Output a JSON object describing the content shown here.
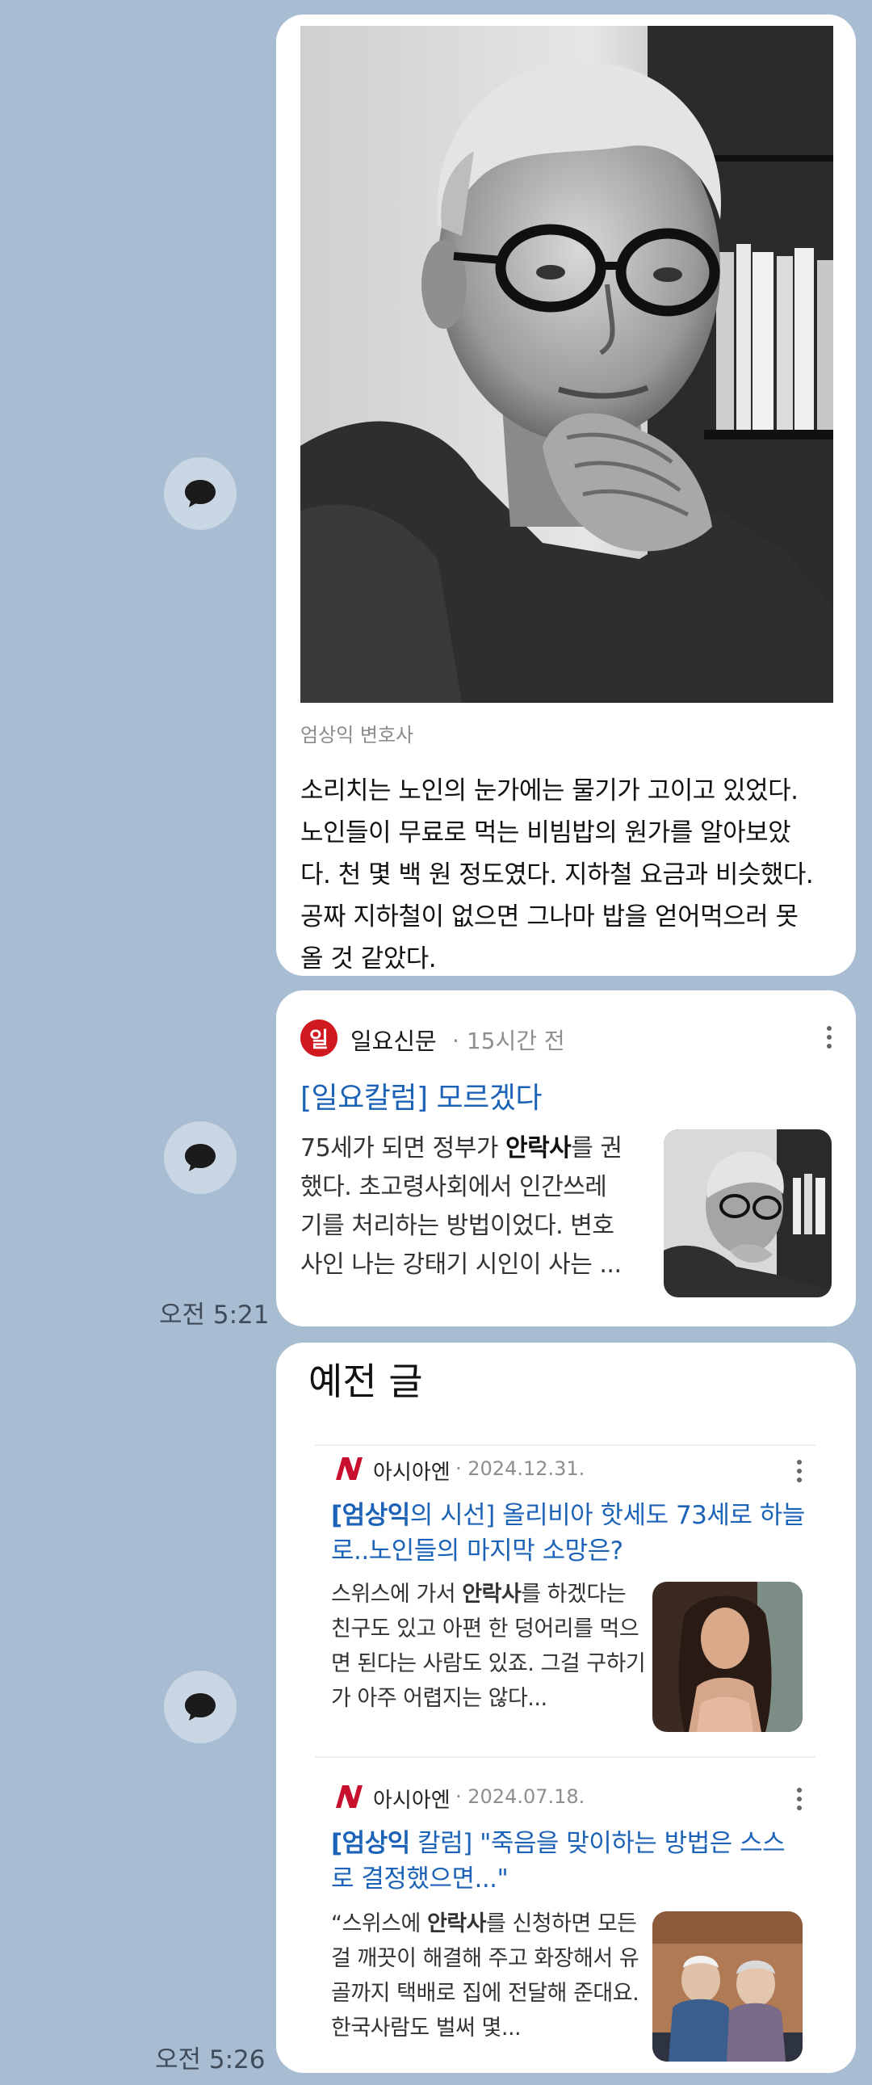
{
  "messages": [
    {
      "caption": "엄상익 변호사",
      "body_lines": [
        "소리치는 노인의 눈가에는 물기가 고이고 있었다.",
        "노인들이 무료로 먹는 비빔밥의 원가를 알아보았",
        "다. 천 몇 백 원 정도였다. 지하철 요금과 비슷했다.",
        "공짜 지하철이 없으면 그나마 밥을 얻어먹으러 못",
        "올 것 같았다."
      ]
    },
    {
      "source": "일요신문",
      "source_initial": "일",
      "time": "15시간 전",
      "headline": "[일요칼럼] 모르겠다",
      "snippet": [
        "75세가 되면 정부가 ",
        "안락사",
        "를 권",
        "했다. 초고령사회에서 인간쓰레",
        "기를 처리하는 방법이었다. 변호",
        "사인 나는 강태기 시인이 사는 ..."
      ],
      "timestamp": "오전 5:21"
    },
    {
      "section_title": "예전 글",
      "items": [
        {
          "source": "아시아엔",
          "date": "2024.12.31.",
          "headline_bold": "[엄상익",
          "headline_rest": "의 시선] 올리비아 핫세도 73세로 하늘로..노인들의 마지막 소망은?",
          "snippet_pre": "스위스에 가서 ",
          "snippet_bold": "안락사",
          "snippet_post": "를 하겠다는 친구도 있고 아편 한 덩어리를 먹으면 된다는 사람도 있죠. 그걸 구하기가 아주 어렵지는 않다..."
        },
        {
          "source": "아시아엔",
          "date": "2024.07.18.",
          "headline_bold": "[엄상익",
          "headline_rest": " 칼럼] \"죽음을 맞이하는 방법은 스스로 결정했으면...\"",
          "snippet_pre": "“스위스에 ",
          "snippet_bold": "안락사",
          "snippet_post": "를 신청하면 모든 걸 깨끗이 해결해 주고 화장해서 유골까지 택배로 집에 전달해 준대요. 한국사람도 벌써 몇..."
        }
      ],
      "timestamp": "오전 5:26"
    }
  ],
  "icons": {
    "share": "speech-bubble-icon",
    "more": "more-vertical-icon"
  },
  "colors": {
    "background": "#a9bdd2",
    "link": "#1c63b7",
    "ilyo_logo": "#d0191f",
    "asiaN_logo": "#c8102e"
  }
}
